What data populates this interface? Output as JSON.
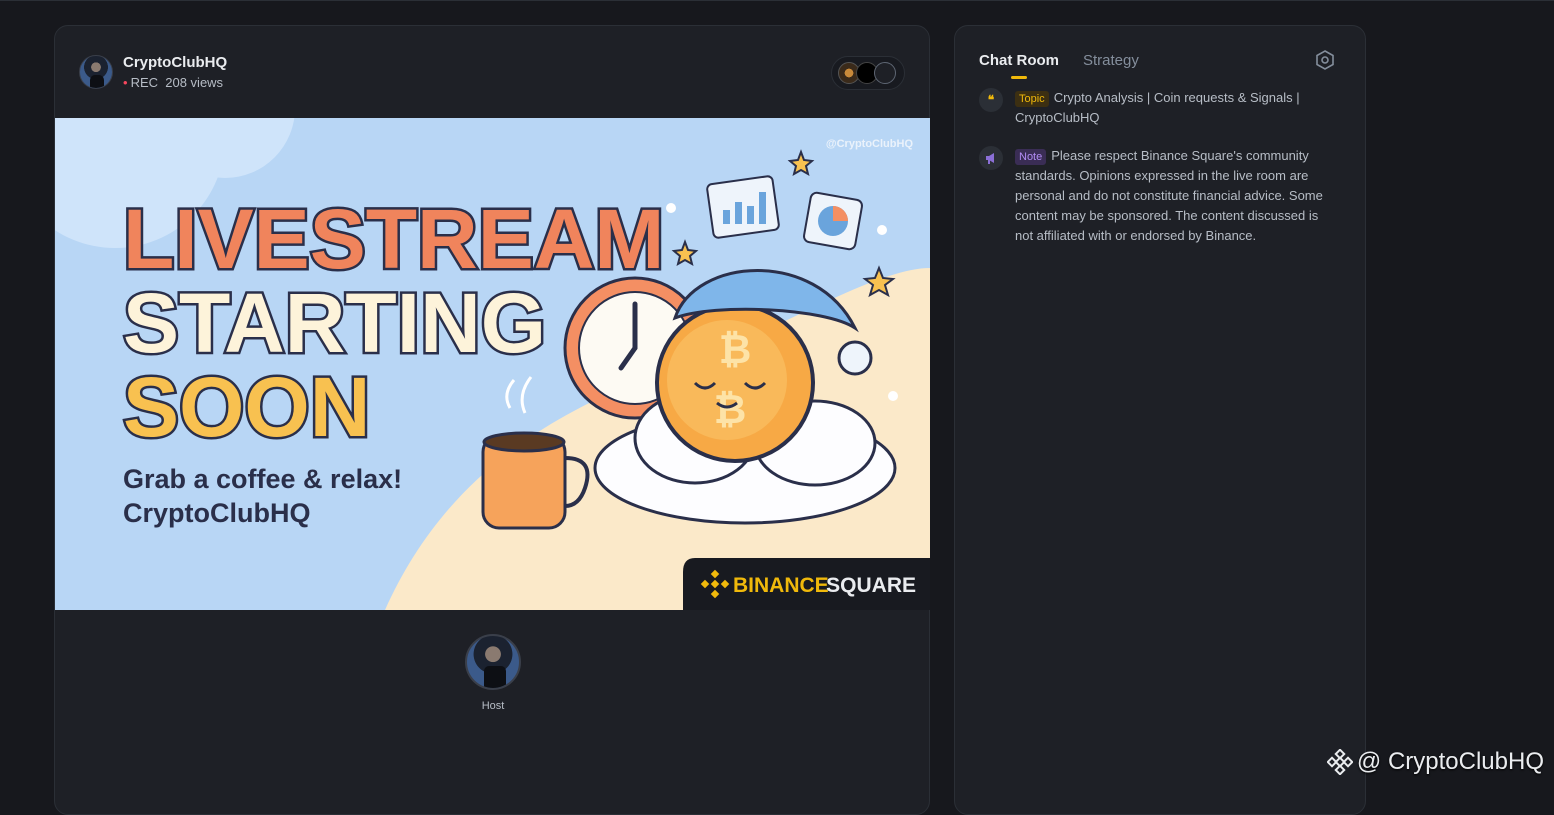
{
  "stream": {
    "channel_name": "CryptoClubHQ",
    "rec_label": "REC",
    "views": "208 views",
    "host_label": "Host"
  },
  "banner": {
    "line1": "LIVESTREAM",
    "line2": "STARTING",
    "line3": "SOON",
    "tagline1": "Grab a coffee & relax!",
    "tagline2": "CryptoClubHQ",
    "handle": "@CryptoClubHQ",
    "brand_left": "BINANCE",
    "brand_right": "SQUARE"
  },
  "chat": {
    "tabs": [
      {
        "label": "Chat Room",
        "active": true
      },
      {
        "label": "Strategy",
        "active": false
      }
    ],
    "topic_badge": "Topic",
    "topic_text": "Crypto Analysis | Coin requests & Signals | CryptoClubHQ",
    "note_badge": "Note",
    "note_text": "Please respect Binance Square's community standards. Opinions expressed in the live room are personal and do not constitute financial advice. Some content may be sponsored. The content discussed is not affiliated with or endorsed by Binance."
  },
  "watermark": "@ CryptoClubHQ",
  "colors": {
    "accent": "#f0b90b",
    "background": "#17181d",
    "panel": "#1e2026",
    "rec_dot": "#f6465d",
    "note_purple": "#b28cf5"
  }
}
